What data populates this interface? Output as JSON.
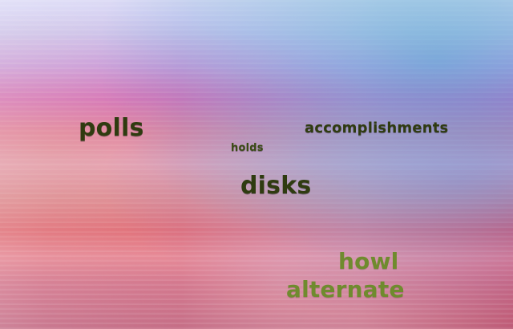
{
  "words": {
    "polls": "polls",
    "accomplishments": "accomplishments",
    "holds": "holds",
    "disks": "disks",
    "howl": "howl",
    "alternate": "alternate"
  },
  "colors": {
    "dark_text": "#2f3b10",
    "green_text": "#6f8b2e"
  }
}
